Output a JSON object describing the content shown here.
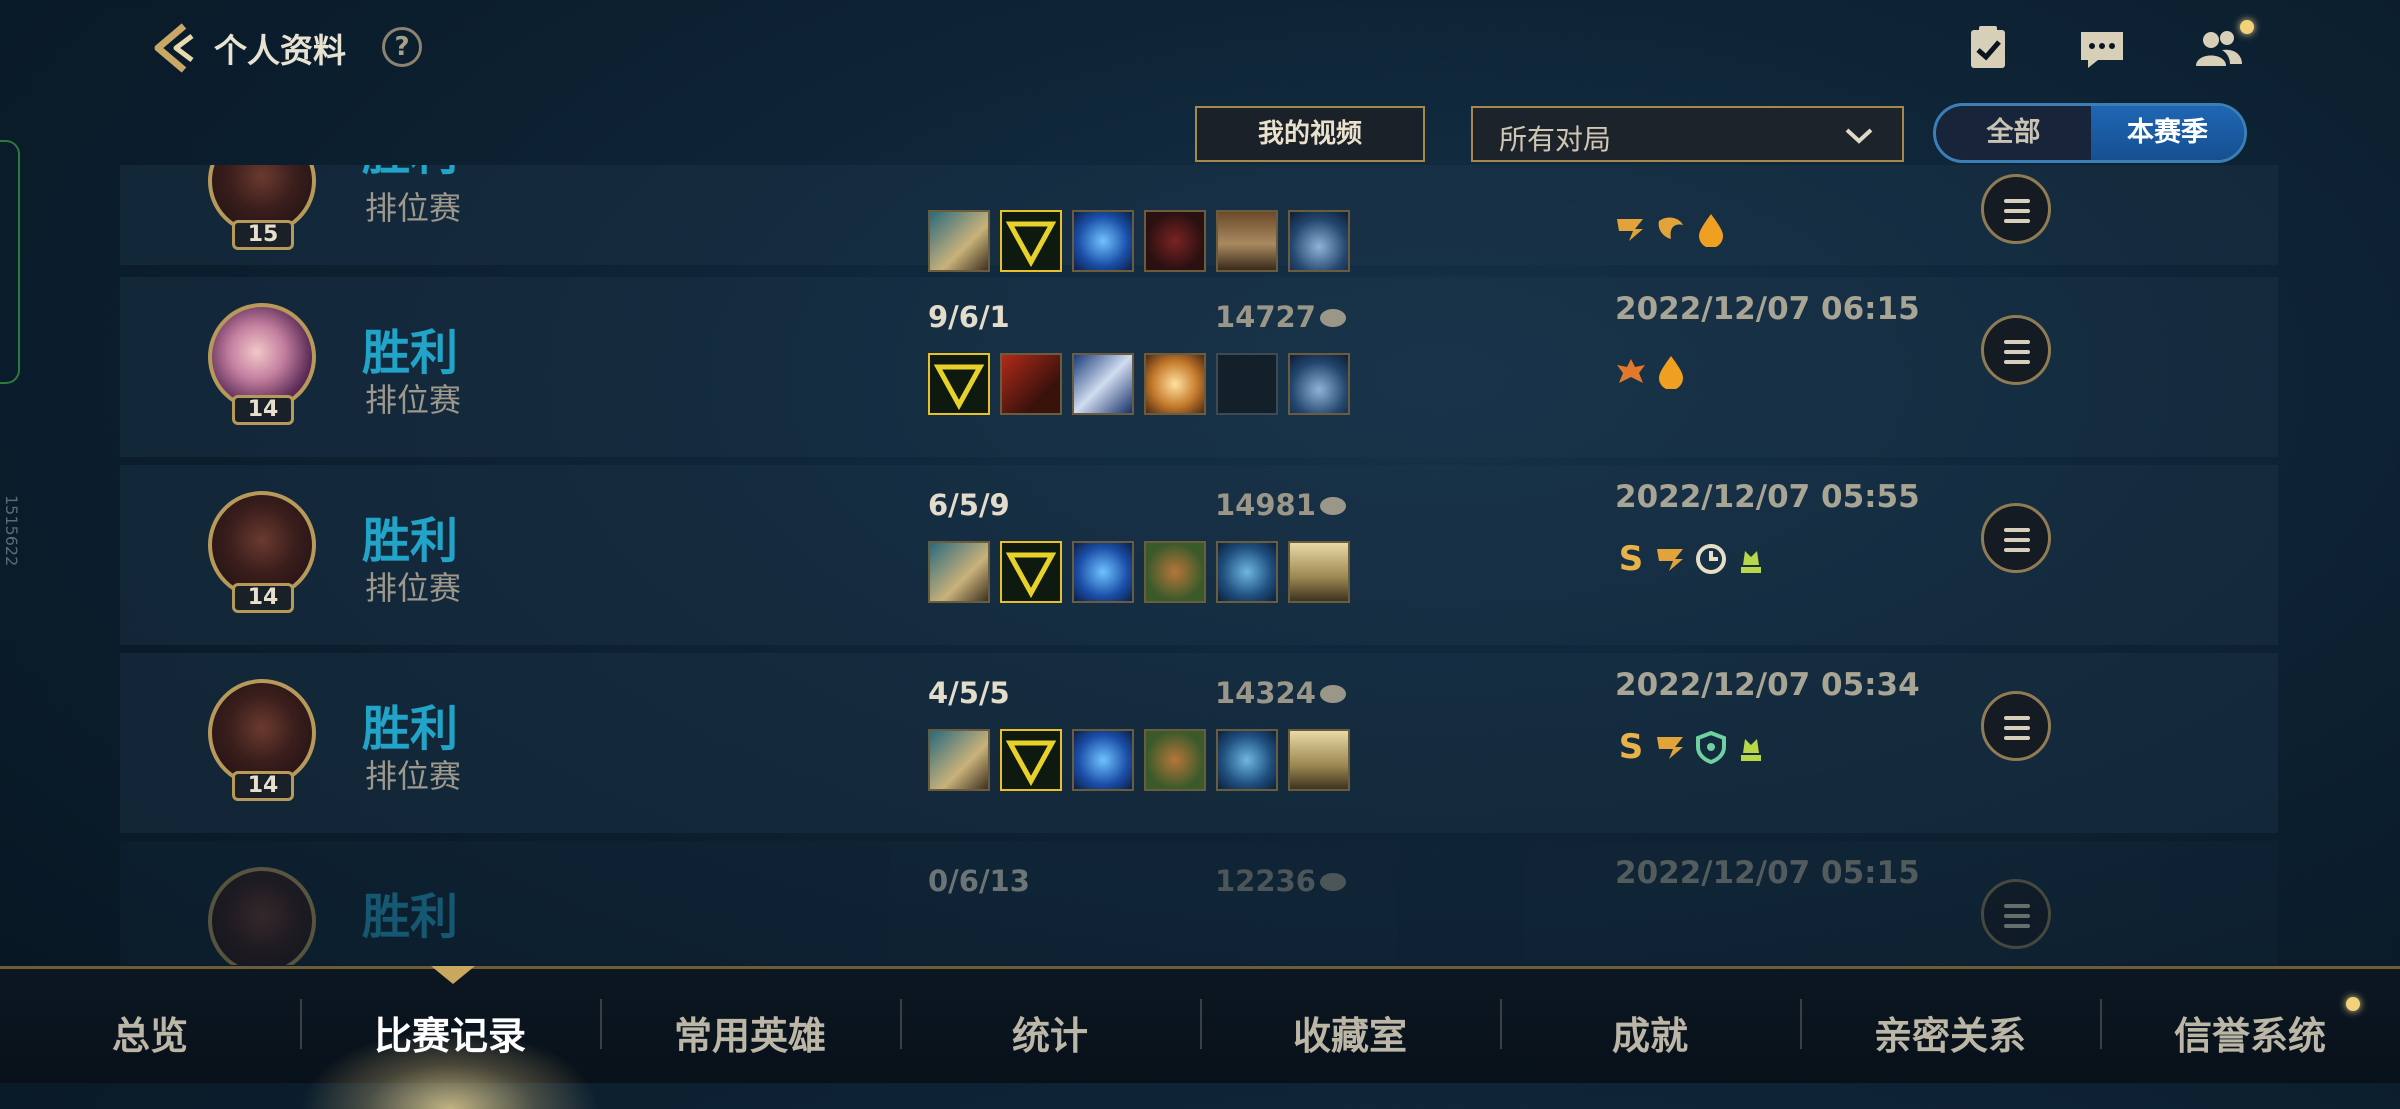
{
  "header": {
    "title": "个人资料",
    "help_label": "?",
    "icons": [
      "back-icon",
      "help-icon",
      "task-icon",
      "chat-icon",
      "friends-icon"
    ]
  },
  "filters": {
    "video_button": "我的视频",
    "mode_select": "所有对局",
    "season_toggle": {
      "all": "全部",
      "season": "本赛季",
      "selected": "本赛季"
    }
  },
  "side_text": "1515622",
  "matches": [
    {
      "result": "胜利",
      "mode": "排位赛",
      "level": "15",
      "kda": "",
      "gold": "",
      "date": "",
      "items": [
        "sword-item",
        "triforce-item",
        "blue-crystal-item",
        "red-mask-item",
        "boots-item",
        "trinket-item"
      ],
      "badges": [
        "double-kill-badge",
        "triple-kill-badge",
        "first-blood-badge"
      ]
    },
    {
      "result": "胜利",
      "mode": "排位赛",
      "level": "14",
      "kda": "9/6/1",
      "gold": "14727",
      "date": "2022/12/07 06:15",
      "items": [
        "triforce-item",
        "fire-sword-item",
        "blue-blade-item",
        "golden-cross-item",
        "empty-slot",
        "trinket-item"
      ],
      "badges": [
        "mvp-wing-badge",
        "first-blood-badge"
      ]
    },
    {
      "result": "胜利",
      "mode": "排位赛",
      "level": "14",
      "kda": "6/5/9",
      "gold": "14981",
      "date": "2022/12/07 05:55",
      "items": [
        "sword-item",
        "triforce-item",
        "blue-crystal-item",
        "armor-item",
        "blue-vest-item",
        "golden-trinket-item"
      ],
      "badges": [
        "s-rank-badge",
        "double-kill-badge",
        "timer-badge",
        "crown-badge"
      ]
    },
    {
      "result": "胜利",
      "mode": "排位赛",
      "level": "14",
      "kda": "4/5/5",
      "gold": "14324",
      "date": "2022/12/07 05:34",
      "items": [
        "sword-item",
        "triforce-item",
        "blue-crystal-item",
        "armor-item",
        "blue-vest-item",
        "golden-trinket-item"
      ],
      "badges": [
        "s-rank-badge",
        "double-kill-badge",
        "shield-badge",
        "crown-badge"
      ]
    },
    {
      "result": "胜利",
      "mode": "",
      "level": "",
      "kda": "0/6/13",
      "gold": "12236",
      "date": "2022/12/07 05:15",
      "items": [],
      "badges": []
    }
  ],
  "nav": {
    "tabs": [
      "总览",
      "比赛记录",
      "常用英雄",
      "统计",
      "收藏室",
      "成就",
      "亲密关系",
      "信誉系统"
    ],
    "active": "比赛记录"
  },
  "colors": {
    "accent": "#22a3c8",
    "gold_border": "#a7884b",
    "active_blue": "#1f66b3"
  }
}
